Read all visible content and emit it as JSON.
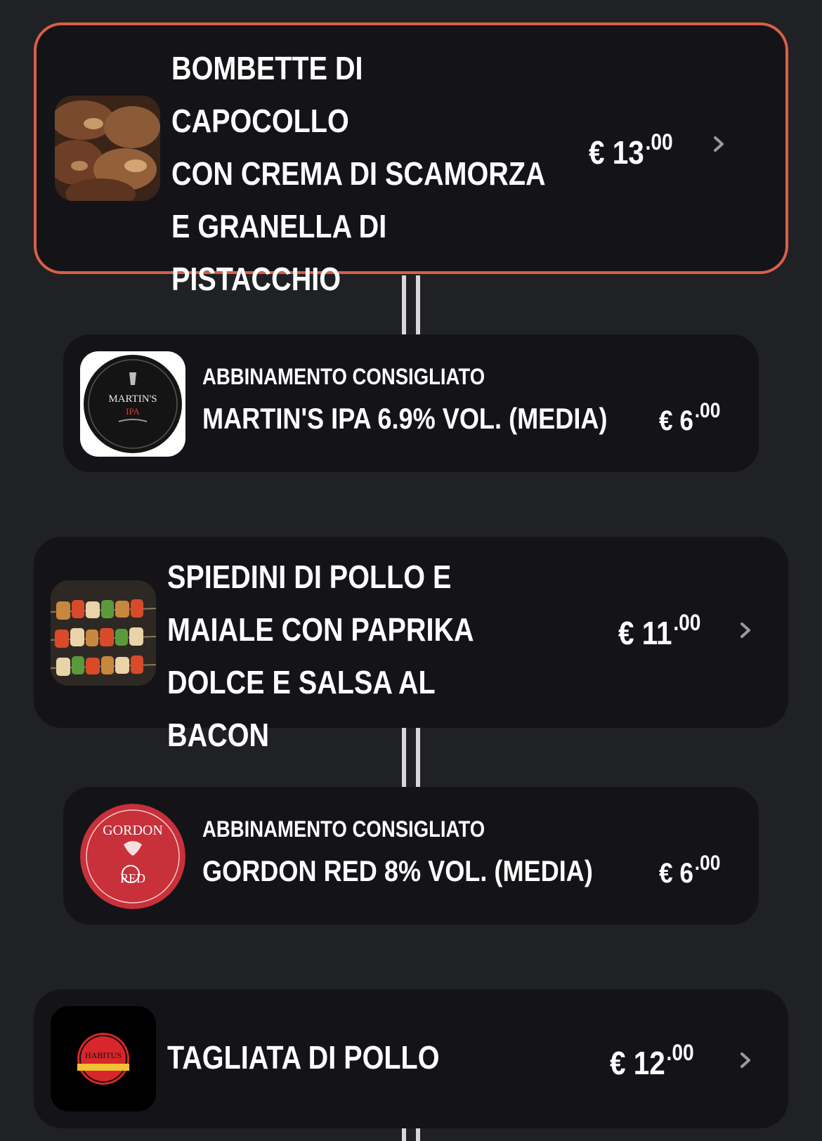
{
  "items": [
    {
      "title_lines": [
        "Bombette di capocollo",
        "con crema di scamorza",
        "e granella di",
        "pistacchio"
      ],
      "price_main": "€ 13",
      "price_cents": ".00",
      "image_icon": "grilled-meat-image",
      "pairing": {
        "label": "Abbinamento consigliato",
        "name": "Martin's IPA 6.9% vol. (media)",
        "price_main": "€ 6",
        "price_cents": ".00",
        "logo_text": "MARTIN'S",
        "logo_subtext": "IPA"
      }
    },
    {
      "title_lines": [
        "Spiedini di pollo e",
        "maiale con paprika",
        "dolce e salsa al bacon"
      ],
      "price_main": "€ 11",
      "price_cents": ".00",
      "image_icon": "skewers-image",
      "pairing": {
        "label": "Abbinamento consigliato",
        "name": "Gordon Red 8% vol. (media)",
        "price_main": "€ 6",
        "price_cents": ".00",
        "logo_text": "GORDON",
        "logo_subtext": "RED"
      }
    },
    {
      "title_lines": [
        "Tagliata di pollo"
      ],
      "price_main": "€ 12",
      "price_cents": ".00",
      "image_icon": "habitus-logo-image",
      "logo_text": "HABITUS"
    }
  ],
  "colors": {
    "background": "#202125",
    "card": "#141418",
    "highlight_border": "#d95f47"
  }
}
